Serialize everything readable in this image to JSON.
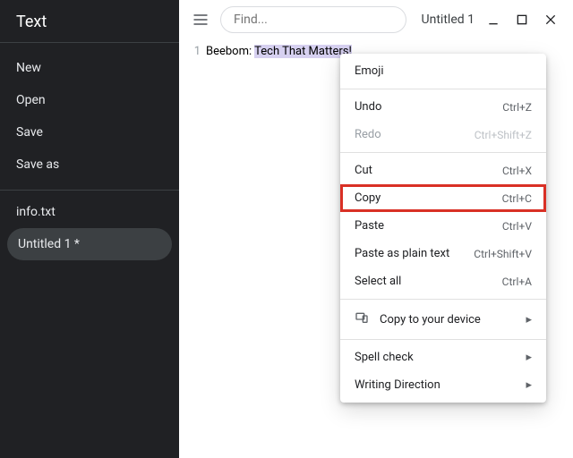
{
  "sidebar": {
    "title": "Text",
    "actions": [
      "New",
      "Open",
      "Save",
      "Save as"
    ],
    "files": [
      {
        "name": "info.txt",
        "active": false
      },
      {
        "name": "Untitled 1 *",
        "active": true
      }
    ]
  },
  "toolbar": {
    "find_placeholder": "Find...",
    "tab_title": "Untitled 1"
  },
  "editor": {
    "line_number": "1",
    "prefix": "Beebom: ",
    "selected": "Tech That Matters!"
  },
  "context_menu": {
    "emoji": "Emoji",
    "undo": {
      "label": "Undo",
      "shortcut": "Ctrl+Z"
    },
    "redo": {
      "label": "Redo",
      "shortcut": "Ctrl+Shift+Z"
    },
    "cut": {
      "label": "Cut",
      "shortcut": "Ctrl+X"
    },
    "copy": {
      "label": "Copy",
      "shortcut": "Ctrl+C"
    },
    "paste": {
      "label": "Paste",
      "shortcut": "Ctrl+V"
    },
    "paste_plain": {
      "label": "Paste as plain text",
      "shortcut": "Ctrl+Shift+V"
    },
    "select_all": {
      "label": "Select all",
      "shortcut": "Ctrl+A"
    },
    "copy_device": "Copy to your device",
    "spell_check": "Spell check",
    "writing_direction": "Writing Direction"
  }
}
